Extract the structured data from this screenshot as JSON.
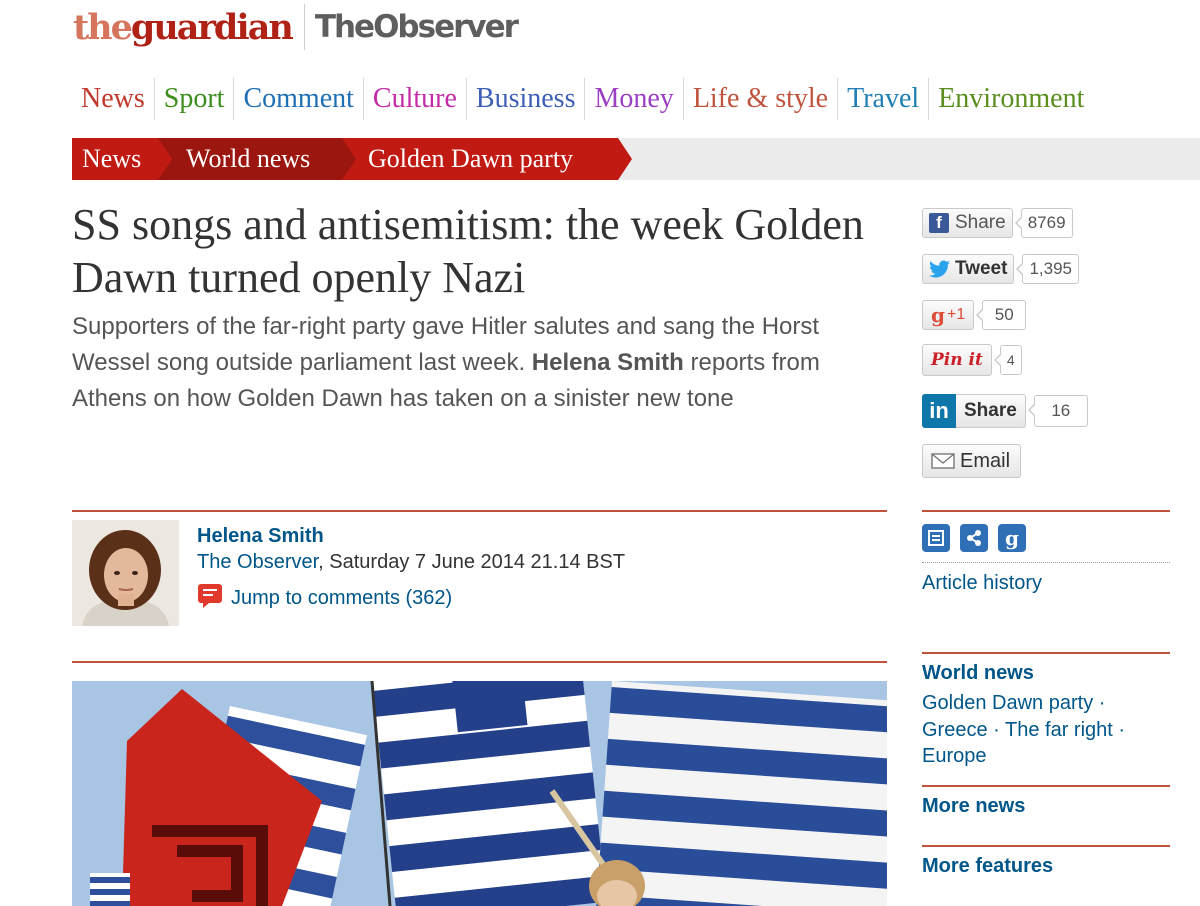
{
  "masthead": {
    "logo_the": "the",
    "logo_guardian": "guardian",
    "logo_observer": "TheObserver"
  },
  "nav": {
    "items": [
      {
        "label": "News",
        "color": "#c0392b"
      },
      {
        "label": "Sport",
        "color": "#3e8e1f"
      },
      {
        "label": "Comment",
        "color": "#1f6fb5"
      },
      {
        "label": "Culture",
        "color": "#c42aa6"
      },
      {
        "label": "Business",
        "color": "#3d5fb5"
      },
      {
        "label": "Money",
        "color": "#9b3fc4"
      },
      {
        "label": "Life & style",
        "color": "#c0533d"
      },
      {
        "label": "Travel",
        "color": "#1f7fb5"
      },
      {
        "label": "Environment",
        "color": "#5a8f1f"
      }
    ]
  },
  "breadcrumb": {
    "items": [
      "News",
      "World news",
      "Golden Dawn party"
    ]
  },
  "article": {
    "headline": "SS songs and antisemitism: the week Golden Dawn turned openly Nazi",
    "standfirst_part1": "Supporters of the far-right party gave Hitler salutes and sang the Horst Wessel song outside parliament last week.",
    "standfirst_author": "Helena Smith",
    "standfirst_part2": "reports from Athens on how Golden Dawn has taken on a sinister new tone",
    "byline_name": "Helena Smith",
    "publication": "The Observer",
    "date": ", Saturday 7 June 2014 21.14 BST",
    "comments_link": "Jump to comments (362)"
  },
  "share": {
    "facebook": {
      "label": "Share",
      "count": "8769",
      "icon": "facebook-icon"
    },
    "twitter": {
      "label": "Tweet",
      "count": "1,395",
      "icon": "twitter-icon"
    },
    "gplus": {
      "label": "+1",
      "count": "50",
      "icon": "google-plus-icon"
    },
    "pinterest": {
      "label": "Pin it",
      "count": "4",
      "icon": "pinterest-icon"
    },
    "linkedin": {
      "label": "Share",
      "count": "16",
      "icon": "linkedin-icon"
    },
    "email": {
      "label": "Email",
      "icon": "email-icon"
    }
  },
  "sidebar": {
    "article_history": "Article history",
    "tool_icons": [
      "print-icon",
      "share-icon",
      "guardian-g-icon"
    ],
    "world_news": "World news",
    "tags": [
      "Golden Dawn party ·",
      "Greece · The far right ·",
      "Europe"
    ],
    "more_news": "More news",
    "more_features": "More features"
  },
  "colors": {
    "breadcrumb_red": "#c11a13",
    "breadcrumb_dark": "#9c1610",
    "link_blue": "#005689",
    "rule_red": "#c0533d"
  }
}
